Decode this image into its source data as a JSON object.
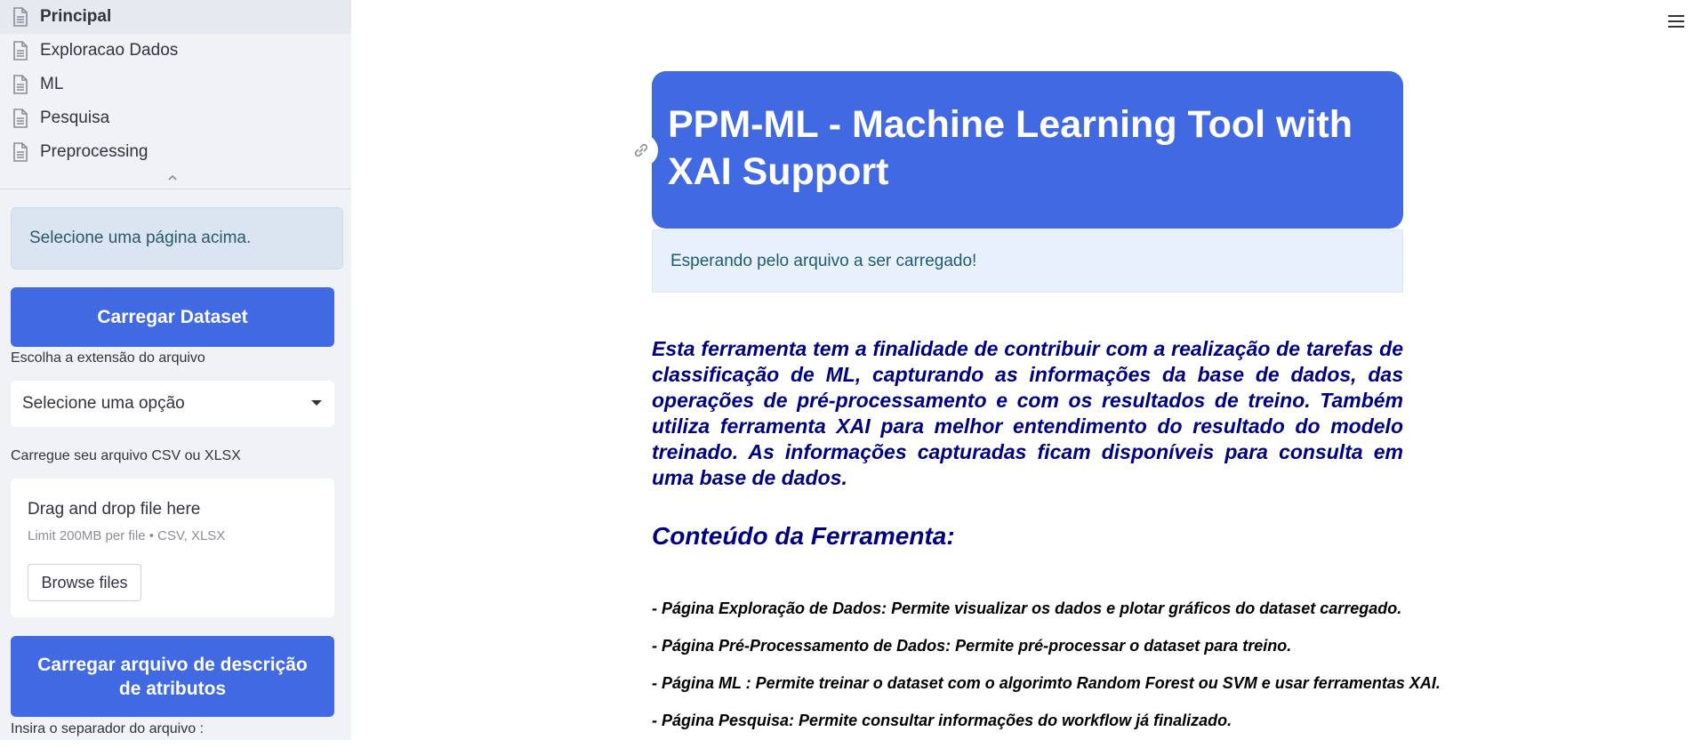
{
  "sidebar": {
    "nav_items": [
      {
        "label": "Principal",
        "active": true
      },
      {
        "label": "Exploracao Dados",
        "active": false
      },
      {
        "label": "ML",
        "active": false
      },
      {
        "label": "Pesquisa",
        "active": false
      },
      {
        "label": "Preprocessing",
        "active": false
      }
    ],
    "info_message": "Selecione uma página acima.",
    "load_dataset_button": "Carregar Dataset",
    "extension_label": "Escolha a extensão do arquivo",
    "extension_select": "Selecione uma opção",
    "upload_label": "Carregue seu arquivo CSV ou XLSX",
    "dropzone": {
      "title": "Drag and drop file here",
      "limit": "Limit 200MB per file • CSV, XLSX",
      "browse_button": "Browse files"
    },
    "load_description_button": "Carregar arquivo de descrição de atributos",
    "separator_label": "Insira o separador do arquivo :"
  },
  "main": {
    "title": "PPM-ML - Machine Learning Tool with XAI Support",
    "status_message": "Esperando pelo arquivo a ser carregado!",
    "description": "Esta ferramenta tem a finalidade de contribuir com a realização de tarefas de classificação de ML, capturando as informações da base de dados, das operações de pré-processamento e com os resultados de treino. Também utiliza ferramenta XAI para melhor entendimento do resultado do modelo treinado. As informações capturadas ficam disponíveis para consulta em uma base de dados.",
    "section_title": "Conteúdo da Ferramenta:",
    "features": [
      "- Página Exploração de Dados: Permite visualizar os dados e plotar gráficos do dataset carregado.",
      "- Página Pré-Processamento de Dados: Permite pré-processar o dataset para treino.",
      "- Página ML : Permite treinar o dataset com o algorimto Random Forest ou SVM e usar ferramentas XAI.",
      "- Página Pesquisa: Permite consultar informações do workflow já finalizado."
    ]
  },
  "colors": {
    "accent": "#4169e1",
    "text_navy": "#000080",
    "sidebar_bg": "#f0f2f6"
  },
  "icons": {
    "nav": "document-icon",
    "collapse": "chevron-up-icon",
    "menu": "hamburger-menu-icon",
    "anchor": "link-icon",
    "select": "caret-down-icon"
  }
}
